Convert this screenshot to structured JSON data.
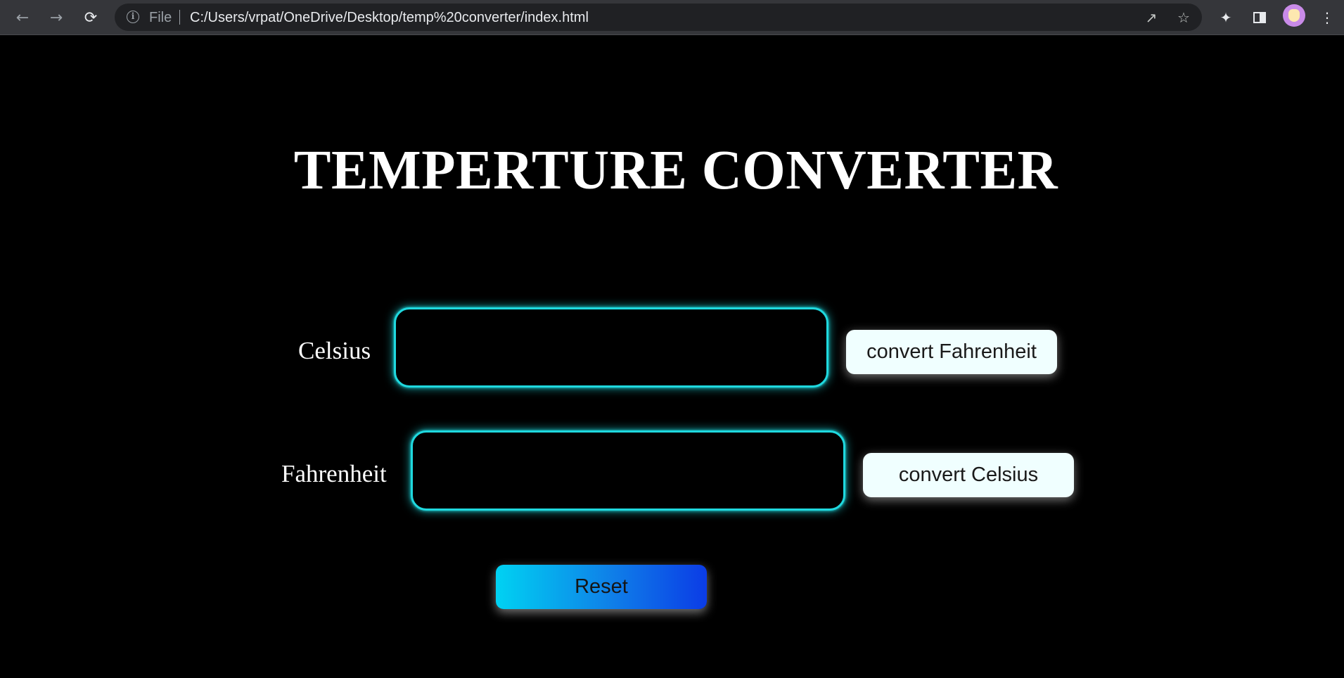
{
  "browser": {
    "url_scheme_label": "File",
    "url": "C:/Users/vrpat/OneDrive/Desktop/temp%20converter/index.html",
    "icons": {
      "back": "arrow-left",
      "forward": "arrow-right",
      "reload": "reload",
      "site_info": "info-circle",
      "share": "share",
      "bookmark": "star",
      "extensions": "puzzle-piece",
      "side_panel": "side-panel",
      "profile": "avatar",
      "menu": "three-dots-vertical"
    }
  },
  "page": {
    "title": "TEMPERTURE CONVERTER",
    "celsius": {
      "label": "Celsius",
      "value": "",
      "button_label": "convert Fahrenheit"
    },
    "fahrenheit": {
      "label": "Fahrenheit",
      "value": "",
      "button_label": "convert Celsius"
    },
    "reset_label": "Reset"
  },
  "colors": {
    "background": "#000000",
    "input_glow": "#1fd9df",
    "button_bg": "#f0ffff",
    "reset_gradient_start": "#00d2f2",
    "reset_gradient_end": "#0b3ce6"
  }
}
